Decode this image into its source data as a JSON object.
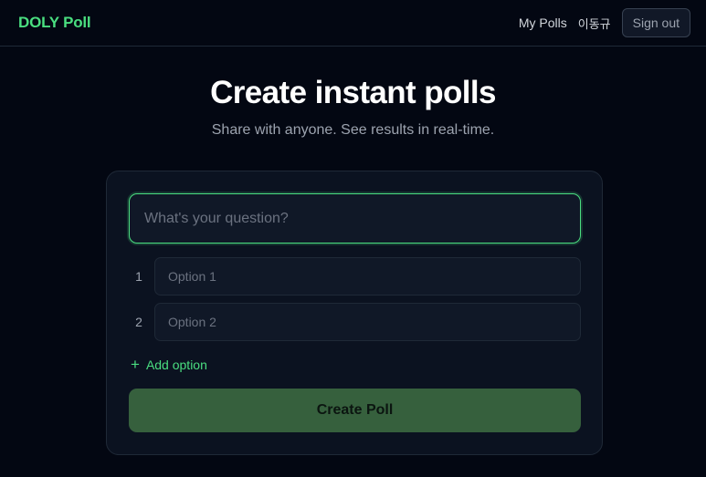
{
  "header": {
    "brand": "DOLY Poll",
    "my_polls": "My Polls",
    "user_name": "이동규",
    "sign_out": "Sign out"
  },
  "hero": {
    "title": "Create instant polls",
    "subtitle": "Share with anyone. See results in real-time."
  },
  "form": {
    "question_placeholder": "What's your question?",
    "question_value": "",
    "options": [
      {
        "number": "1",
        "placeholder": "Option 1",
        "value": ""
      },
      {
        "number": "2",
        "placeholder": "Option 2",
        "value": ""
      }
    ],
    "add_option_icon": "+",
    "add_option_label": "Add option",
    "submit_label": "Create Poll"
  },
  "colors": {
    "accent": "#4ade80",
    "background": "#030712",
    "card": "#0b1220",
    "button": "#36603d"
  }
}
